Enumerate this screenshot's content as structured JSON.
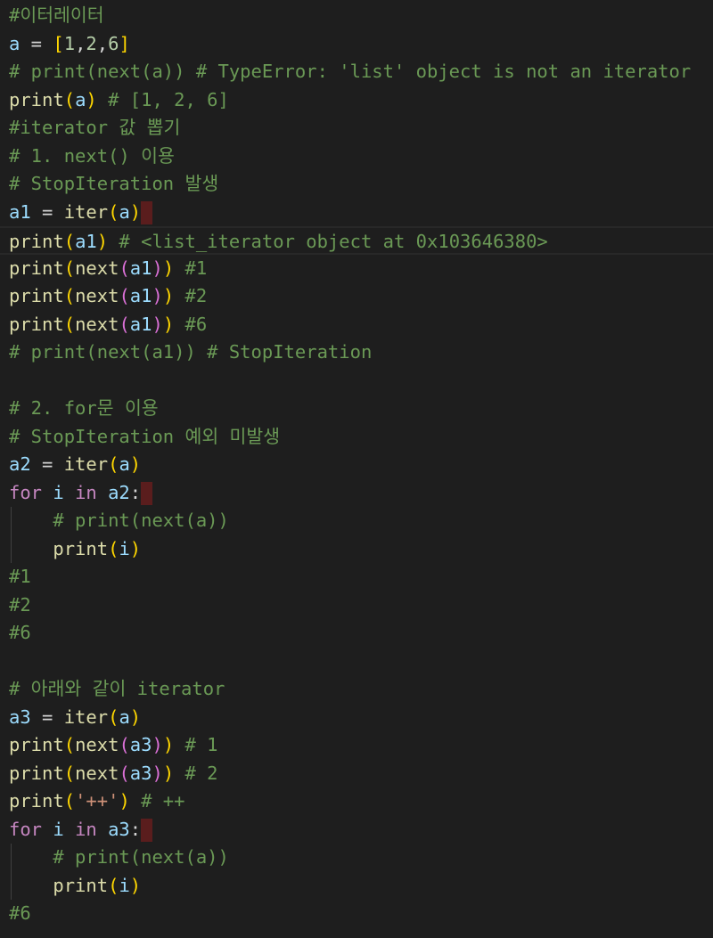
{
  "editor": {
    "lines": [
      [
        {
          "t": "#이터레이터",
          "c": "comment"
        }
      ],
      [
        {
          "t": "a",
          "c": "var"
        },
        {
          "t": " = ",
          "c": "op"
        },
        {
          "t": "[",
          "c": "paren1"
        },
        {
          "t": "1",
          "c": "num"
        },
        {
          "t": ",",
          "c": "op"
        },
        {
          "t": "2",
          "c": "num"
        },
        {
          "t": ",",
          "c": "op"
        },
        {
          "t": "6",
          "c": "num"
        },
        {
          "t": "]",
          "c": "paren1"
        }
      ],
      [
        {
          "t": "# print(next(a)) # TypeError: 'list' object is not an iterator",
          "c": "comment"
        }
      ],
      [
        {
          "t": "print",
          "c": "func"
        },
        {
          "t": "(",
          "c": "paren1"
        },
        {
          "t": "a",
          "c": "var"
        },
        {
          "t": ")",
          "c": "paren1"
        },
        {
          "t": " # [1, 2, 6]",
          "c": "comment"
        }
      ],
      [
        {
          "t": "#iterator 값 뽑기",
          "c": "comment"
        }
      ],
      [
        {
          "t": "# 1. next() 이용",
          "c": "comment"
        }
      ],
      [
        {
          "t": "# StopIteration 발생",
          "c": "comment"
        }
      ],
      [
        {
          "t": "a1",
          "c": "var"
        },
        {
          "t": " = ",
          "c": "op"
        },
        {
          "t": "iter",
          "c": "func"
        },
        {
          "t": "(",
          "c": "paren1"
        },
        {
          "t": "a",
          "c": "var"
        },
        {
          "t": ")",
          "c": "paren1"
        },
        {
          "cursor": true
        }
      ],
      [
        {
          "t": "print",
          "c": "func"
        },
        {
          "t": "(",
          "c": "paren1"
        },
        {
          "t": "a1",
          "c": "var"
        },
        {
          "t": ")",
          "c": "paren1"
        },
        {
          "t": " # <list_iterator object at 0x103646380>",
          "c": "comment"
        }
      ],
      [
        {
          "t": "print",
          "c": "func"
        },
        {
          "t": "(",
          "c": "paren1"
        },
        {
          "t": "next",
          "c": "func"
        },
        {
          "t": "(",
          "c": "paren2"
        },
        {
          "t": "a1",
          "c": "var"
        },
        {
          "t": ")",
          "c": "paren2"
        },
        {
          "t": ")",
          "c": "paren1"
        },
        {
          "t": " #1",
          "c": "comment"
        }
      ],
      [
        {
          "t": "print",
          "c": "func"
        },
        {
          "t": "(",
          "c": "paren1"
        },
        {
          "t": "next",
          "c": "func"
        },
        {
          "t": "(",
          "c": "paren2"
        },
        {
          "t": "a1",
          "c": "var"
        },
        {
          "t": ")",
          "c": "paren2"
        },
        {
          "t": ")",
          "c": "paren1"
        },
        {
          "t": " #2",
          "c": "comment"
        }
      ],
      [
        {
          "t": "print",
          "c": "func"
        },
        {
          "t": "(",
          "c": "paren1"
        },
        {
          "t": "next",
          "c": "func"
        },
        {
          "t": "(",
          "c": "paren2"
        },
        {
          "t": "a1",
          "c": "var"
        },
        {
          "t": ")",
          "c": "paren2"
        },
        {
          "t": ")",
          "c": "paren1"
        },
        {
          "t": " #6",
          "c": "comment"
        }
      ],
      [
        {
          "t": "# print(next(a1)) # StopIteration",
          "c": "comment"
        }
      ],
      [],
      [
        {
          "t": "# 2. for문 이용",
          "c": "comment"
        }
      ],
      [
        {
          "t": "# StopIteration 예외 미발생",
          "c": "comment"
        }
      ],
      [
        {
          "t": "a2",
          "c": "var"
        },
        {
          "t": " = ",
          "c": "op"
        },
        {
          "t": "iter",
          "c": "func"
        },
        {
          "t": "(",
          "c": "paren1"
        },
        {
          "t": "a",
          "c": "var"
        },
        {
          "t": ")",
          "c": "paren1"
        }
      ],
      [
        {
          "t": "for",
          "c": "keyword"
        },
        {
          "t": " ",
          "c": "op"
        },
        {
          "t": "i",
          "c": "var"
        },
        {
          "t": " ",
          "c": "op"
        },
        {
          "t": "in",
          "c": "keyword"
        },
        {
          "t": " ",
          "c": "op"
        },
        {
          "t": "a2",
          "c": "var"
        },
        {
          "t": ":",
          "c": "op"
        },
        {
          "cursor": true
        }
      ],
      [
        {
          "t": "    # print(next(a))",
          "c": "comment"
        }
      ],
      [
        {
          "t": "    ",
          "c": "op"
        },
        {
          "t": "print",
          "c": "func"
        },
        {
          "t": "(",
          "c": "paren1"
        },
        {
          "t": "i",
          "c": "var"
        },
        {
          "t": ")",
          "c": "paren1"
        }
      ],
      [
        {
          "t": "#1",
          "c": "comment"
        }
      ],
      [
        {
          "t": "#2",
          "c": "comment"
        }
      ],
      [
        {
          "t": "#6",
          "c": "comment"
        }
      ],
      [],
      [
        {
          "t": "# 아래와 같이 iterator",
          "c": "comment"
        }
      ],
      [
        {
          "t": "a3",
          "c": "var"
        },
        {
          "t": " = ",
          "c": "op"
        },
        {
          "t": "iter",
          "c": "func"
        },
        {
          "t": "(",
          "c": "paren1"
        },
        {
          "t": "a",
          "c": "var"
        },
        {
          "t": ")",
          "c": "paren1"
        }
      ],
      [
        {
          "t": "print",
          "c": "func"
        },
        {
          "t": "(",
          "c": "paren1"
        },
        {
          "t": "next",
          "c": "func"
        },
        {
          "t": "(",
          "c": "paren2"
        },
        {
          "t": "a3",
          "c": "var"
        },
        {
          "t": ")",
          "c": "paren2"
        },
        {
          "t": ")",
          "c": "paren1"
        },
        {
          "t": " # 1",
          "c": "comment"
        }
      ],
      [
        {
          "t": "print",
          "c": "func"
        },
        {
          "t": "(",
          "c": "paren1"
        },
        {
          "t": "next",
          "c": "func"
        },
        {
          "t": "(",
          "c": "paren2"
        },
        {
          "t": "a3",
          "c": "var"
        },
        {
          "t": ")",
          "c": "paren2"
        },
        {
          "t": ")",
          "c": "paren1"
        },
        {
          "t": " # 2",
          "c": "comment"
        }
      ],
      [
        {
          "t": "print",
          "c": "func"
        },
        {
          "t": "(",
          "c": "paren1"
        },
        {
          "t": "'++'",
          "c": "string"
        },
        {
          "t": ")",
          "c": "paren1"
        },
        {
          "t": " # ++",
          "c": "comment"
        }
      ],
      [
        {
          "t": "for",
          "c": "keyword"
        },
        {
          "t": " ",
          "c": "op"
        },
        {
          "t": "i",
          "c": "var"
        },
        {
          "t": " ",
          "c": "op"
        },
        {
          "t": "in",
          "c": "keyword"
        },
        {
          "t": " ",
          "c": "op"
        },
        {
          "t": "a3",
          "c": "var"
        },
        {
          "t": ":",
          "c": "op"
        },
        {
          "cursor": true
        }
      ],
      [
        {
          "t": "    # print(next(a))",
          "c": "comment"
        }
      ],
      [
        {
          "t": "    ",
          "c": "op"
        },
        {
          "t": "print",
          "c": "func"
        },
        {
          "t": "(",
          "c": "paren1"
        },
        {
          "t": "i",
          "c": "var"
        },
        {
          "t": ")",
          "c": "paren1"
        }
      ],
      [
        {
          "t": "#6",
          "c": "comment"
        }
      ]
    ],
    "active_line": 8,
    "indent_blocks": [
      [
        18,
        19
      ],
      [
        30,
        31
      ]
    ],
    "colors": {
      "background": "#1e1e1e",
      "comment": "#6a9955",
      "function": "#dcdcaa",
      "variable": "#9cdcfe",
      "number": "#b5cea8",
      "keyword": "#c586c0",
      "string": "#ce9178",
      "bracket_level_1": "#ffd700",
      "bracket_level_2": "#da70d6",
      "cursor_marker": "#5a1d1d"
    }
  }
}
